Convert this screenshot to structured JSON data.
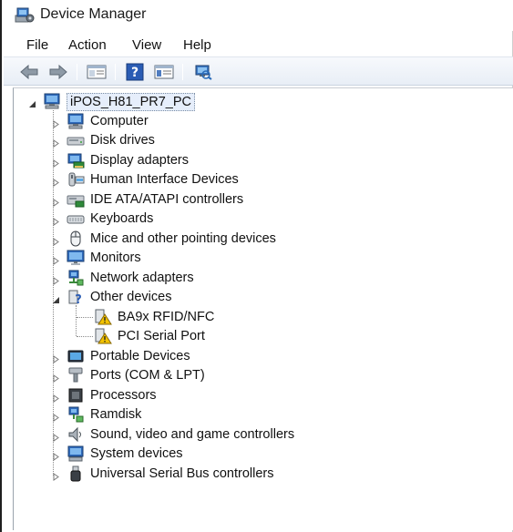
{
  "window": {
    "title": "Device Manager"
  },
  "menu": {
    "file": "File",
    "action": "Action",
    "view": "View",
    "help": "Help"
  },
  "toolbar": {
    "buttons": [
      "back-icon",
      "forward-icon",
      "show-hide-console-tree-icon",
      "help-icon",
      "properties-icon",
      "scan-hardware-icon"
    ]
  },
  "tree": {
    "root": {
      "label": "iPOS_H81_PR7_PC",
      "icon": "computer-icon",
      "expanded": true
    },
    "categories": [
      {
        "label": "Computer",
        "icon": "computer-icon",
        "expanded": false
      },
      {
        "label": "Disk drives",
        "icon": "disk-drive-icon",
        "expanded": false
      },
      {
        "label": "Display adapters",
        "icon": "display-adapter-icon",
        "expanded": false
      },
      {
        "label": "Human Interface Devices",
        "icon": "hid-icon",
        "expanded": false
      },
      {
        "label": "IDE ATA/ATAPI controllers",
        "icon": "ide-controller-icon",
        "expanded": false
      },
      {
        "label": "Keyboards",
        "icon": "keyboard-icon",
        "expanded": false
      },
      {
        "label": "Mice and other pointing devices",
        "icon": "mouse-icon",
        "expanded": false
      },
      {
        "label": "Monitors",
        "icon": "monitor-icon",
        "expanded": false
      },
      {
        "label": "Network adapters",
        "icon": "network-adapter-icon",
        "expanded": false
      },
      {
        "label": "Other devices",
        "icon": "unknown-device-icon",
        "expanded": true,
        "children": [
          {
            "label": "BA9x RFID/NFC",
            "icon": "warning-device-icon"
          },
          {
            "label": "PCI Serial Port",
            "icon": "warning-device-icon"
          }
        ]
      },
      {
        "label": "Portable Devices",
        "icon": "portable-device-icon",
        "expanded": false
      },
      {
        "label": "Ports (COM & LPT)",
        "icon": "port-icon",
        "expanded": false
      },
      {
        "label": "Processors",
        "icon": "processor-icon",
        "expanded": false
      },
      {
        "label": "Ramdisk",
        "icon": "ramdisk-icon",
        "expanded": false
      },
      {
        "label": "Sound, video and game controllers",
        "icon": "sound-icon",
        "expanded": false
      },
      {
        "label": "System devices",
        "icon": "system-devices-icon",
        "expanded": false
      },
      {
        "label": "Universal Serial Bus controllers",
        "icon": "usb-icon",
        "expanded": false
      }
    ]
  },
  "colors": {
    "selection": "#e6eefb",
    "warning": "#f2c200",
    "toolbar_bg": "#e8eef6"
  }
}
